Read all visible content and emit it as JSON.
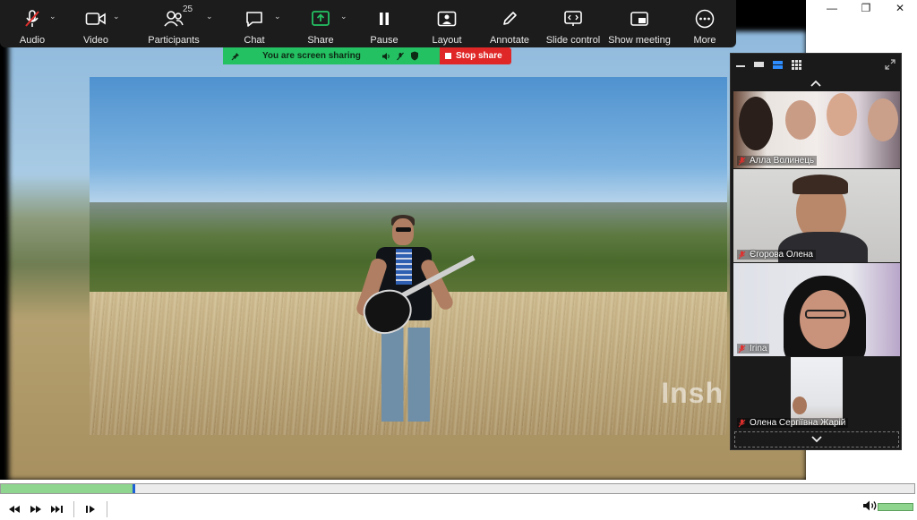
{
  "window": {
    "min": "—",
    "max": "❐",
    "close": "✕"
  },
  "toolbar": {
    "items": [
      {
        "label": "Audio",
        "icon": "mic-muted-icon"
      },
      {
        "label": "Video",
        "icon": "camera-icon"
      },
      {
        "label": "Participants",
        "icon": "participants-icon",
        "count": "25"
      },
      {
        "label": "Chat",
        "icon": "chat-icon"
      },
      {
        "label": "Share",
        "icon": "share-screen-icon"
      },
      {
        "label": "Pause",
        "icon": "pause-icon"
      },
      {
        "label": "Layout",
        "icon": "layout-icon"
      },
      {
        "label": "Annotate",
        "icon": "pencil-icon"
      },
      {
        "label": "Slide control",
        "icon": "slide-control-icon"
      },
      {
        "label": "Show meeting",
        "icon": "show-meeting-icon"
      },
      {
        "label": "More",
        "icon": "more-icon"
      }
    ],
    "share_accent": "#24c163"
  },
  "sharing_banner": {
    "text": "You are screen sharing",
    "stop_label": "Stop share",
    "color": "#24c163",
    "stop_color": "#e02727"
  },
  "video": {
    "watermark": "Insh"
  },
  "panel": {
    "participants": [
      {
        "name": "Алла Волинець",
        "muted": true
      },
      {
        "name": "Єгорова Олена",
        "muted": true
      },
      {
        "name": "Irina",
        "muted": true
      },
      {
        "name": "Олена Сергіївна Жарій",
        "muted": true
      }
    ]
  },
  "player": {
    "progress_fraction": 0.145,
    "volume_fraction": 1.0,
    "progress_color": "#8fd58f"
  }
}
